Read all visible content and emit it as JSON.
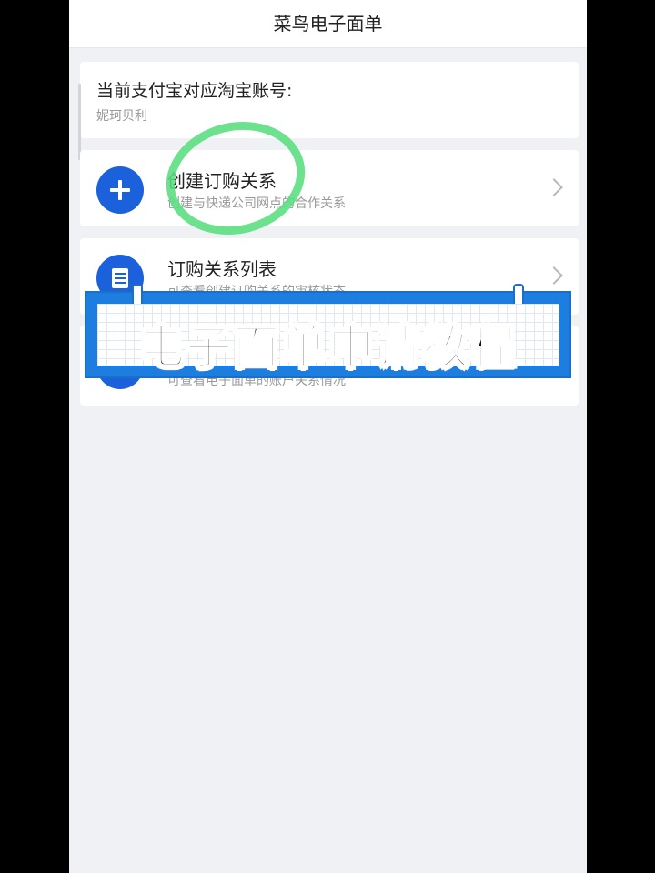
{
  "app": {
    "title": "菜鸟电子面单"
  },
  "account": {
    "label": "当前支付宝对应淘宝账号:",
    "name": "妮珂贝利"
  },
  "menu": [
    {
      "title": "创建订购关系",
      "description": "创建与快递公司网点的合作关系",
      "icon": "plus-icon"
    },
    {
      "title": "订购关系列表",
      "description": "可查看创建订购关系的审核状态",
      "icon": "document-icon"
    },
    {
      "title": "",
      "description": "可查看电子面单的账户关系情况",
      "icon": "circle-icon"
    }
  ],
  "overlay": {
    "banner_text": "电子面单申请教程"
  },
  "colors": {
    "accent": "#1c61dc",
    "highlight": "#58de80",
    "banner": "#1e7ee0"
  }
}
